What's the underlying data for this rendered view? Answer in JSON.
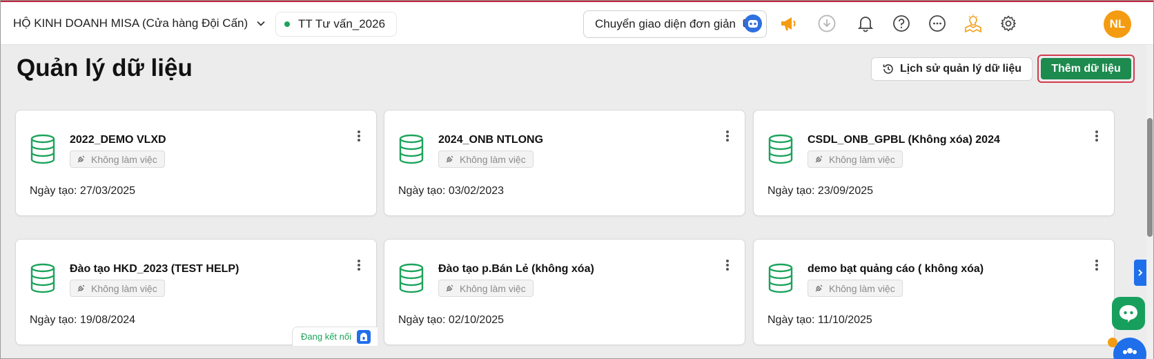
{
  "header": {
    "company_name": "HỘ KINH DOANH MISA (Cửa hàng Đội Cấn)",
    "branch_name": "TT Tư vấn_2026",
    "simple_ui_label": "Chuyển giao diện đơn giản",
    "avatar_initials": "NL",
    "icons": [
      "robot-icon",
      "megaphone-icon",
      "download-icon",
      "bell-icon",
      "help-icon",
      "more-icon",
      "lightbulb-map-icon",
      "settings-icon"
    ]
  },
  "main": {
    "title": "Quản lý dữ liệu",
    "history_label": "Lịch sử quản lý dữ liệu",
    "add_label": "Thêm dữ liệu"
  },
  "cards": [
    {
      "name": "2022_DEMO VLXD",
      "status": "Không làm việc",
      "date": "Ngày tạo: 27/03/2025"
    },
    {
      "name": "2024_ONB NTLONG",
      "status": "Không làm việc",
      "date": "Ngày tạo: 03/02/2023"
    },
    {
      "name": "CSDL_ONB_GPBL (Không xóa) 2024",
      "status": "Không làm việc",
      "date": "Ngày tạo: 23/09/2025"
    },
    {
      "name": "Đào tạo HKD_2023 (TEST HELP)",
      "status": "Không làm việc",
      "date": "Ngày tạo: 19/08/2024",
      "connecting_label": "Đang kết nối"
    },
    {
      "name": "Đào tạo p.Bán Lẻ (không xóa)",
      "status": "Không làm việc",
      "date": "Ngày tạo: 02/10/2025"
    },
    {
      "name": "demo bạt quảng cáo ( không xóa)",
      "status": "Không làm việc",
      "date": "Ngày tạo: 11/10/2025"
    }
  ],
  "colors": {
    "accent_green": "#1d8a4e",
    "database_icon": "#1ba35b",
    "highlight_red": "#d33a4b",
    "avatar_orange": "#f39c12",
    "brand_blue": "#1f6feb"
  }
}
